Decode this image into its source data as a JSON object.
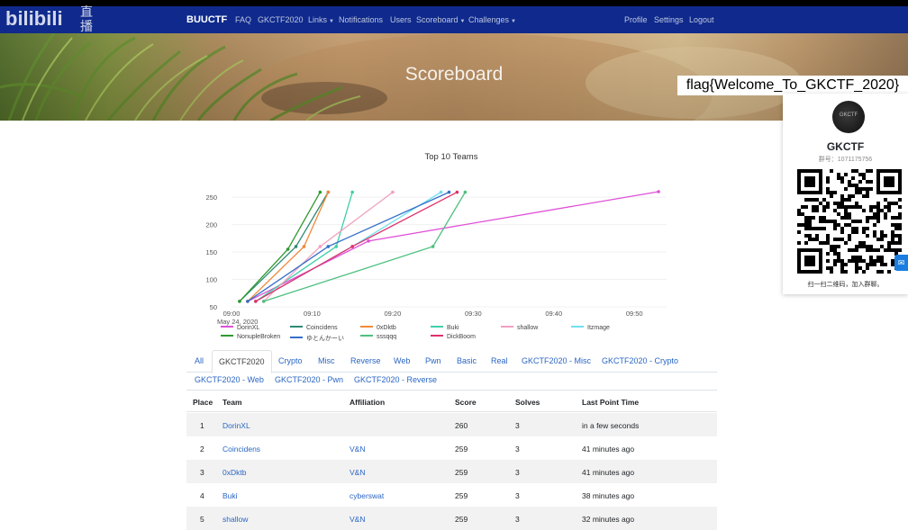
{
  "logo": {
    "text": "bilibili",
    "live_char_1": "直",
    "live_char_2": "播"
  },
  "navbar": {
    "brand": "BUUCTF",
    "left_items": [
      {
        "label": "FAQ"
      },
      {
        "label": "GKCTF2020"
      },
      {
        "label": "Links",
        "dropdown": true
      },
      {
        "label": "Notifications"
      },
      {
        "label": "Users"
      },
      {
        "label": "Scoreboard",
        "dropdown": true
      },
      {
        "label": "Challenges",
        "dropdown": true
      }
    ],
    "right_items": [
      {
        "label": "Profile"
      },
      {
        "label": "Settings"
      },
      {
        "label": "Logout"
      }
    ]
  },
  "hero": {
    "title": "Scoreboard"
  },
  "overlay": {
    "flag_text": "flag{Welcome_To_GKCTF_2020}",
    "group_name": "GKCTF",
    "group_id": "群号：1071175756",
    "qr_caption": "扫一扫二维码，加入群聊。",
    "avatar_text": "GKCTF"
  },
  "chart_data": {
    "type": "line",
    "title": "Top 10 Teams",
    "x_date_label": "May 24, 2020",
    "x_ticks": [
      "09:00",
      "09:10",
      "09:20",
      "09:30",
      "09:40",
      "09:50"
    ],
    "y_ticks": [
      50,
      100,
      150,
      200,
      250
    ],
    "xlim": [
      "09:00",
      "09:54"
    ],
    "ylim": [
      50,
      260
    ],
    "series": [
      {
        "name": "DorinXL",
        "color": "#e050d8",
        "points": [
          [
            "09:02",
            60
          ],
          [
            "09:17",
            170
          ],
          [
            "09:53",
            260
          ]
        ]
      },
      {
        "name": "Coincidens",
        "color": "#2e8b75",
        "points": [
          [
            "09:01",
            60
          ],
          [
            "09:08",
            160
          ],
          [
            "09:12",
            259
          ]
        ]
      },
      {
        "name": "0xDktb",
        "color": "#f08a3a",
        "points": [
          [
            "09:02",
            60
          ],
          [
            "09:09",
            160
          ],
          [
            "09:12",
            259
          ]
        ]
      },
      {
        "name": "Buki",
        "color": "#3fd0a8",
        "points": [
          [
            "09:03",
            60
          ],
          [
            "09:13",
            160
          ],
          [
            "09:15",
            259
          ]
        ]
      },
      {
        "name": "shallow",
        "color": "#f0a0c0",
        "points": [
          [
            "09:04",
            60
          ],
          [
            "09:11",
            160
          ],
          [
            "09:20",
            259
          ]
        ]
      },
      {
        "name": "Itzmage",
        "color": "#70e0f0",
        "points": [
          [
            "09:03",
            60
          ],
          [
            "09:15",
            160
          ],
          [
            "09:26",
            259
          ]
        ]
      },
      {
        "name": "NonupleBroken",
        "color": "#2f9a2f",
        "points": [
          [
            "09:01",
            60
          ],
          [
            "09:07",
            155
          ],
          [
            "09:11",
            259
          ]
        ]
      },
      {
        "name": "ゆとんかーい",
        "color": "#3670c8",
        "points": [
          [
            "09:02",
            60
          ],
          [
            "09:12",
            160
          ],
          [
            "09:27",
            259
          ]
        ]
      },
      {
        "name": "sssqqq",
        "color": "#4ec080",
        "points": [
          [
            "09:04",
            60
          ],
          [
            "09:25",
            160
          ],
          [
            "09:29",
            259
          ]
        ]
      },
      {
        "name": "DickBoom",
        "color": "#e0306a",
        "points": [
          [
            "09:03",
            60
          ],
          [
            "09:15",
            160
          ],
          [
            "09:28",
            259
          ]
        ]
      }
    ]
  },
  "tabs": {
    "row1": [
      {
        "label": "All",
        "active": false
      },
      {
        "label": "GKCTF2020",
        "active": true
      },
      {
        "label": "Crypto",
        "active": false
      },
      {
        "label": "Misc",
        "active": false
      },
      {
        "label": "Reverse",
        "active": false
      },
      {
        "label": "Web",
        "active": false
      },
      {
        "label": "Pwn",
        "active": false
      },
      {
        "label": "Basic",
        "active": false
      },
      {
        "label": "Real",
        "active": false
      },
      {
        "label": "GKCTF2020 - Misc",
        "active": false
      },
      {
        "label": "GKCTF2020 - Crypto",
        "active": false
      }
    ],
    "row2": [
      {
        "label": "GKCTF2020 - Web"
      },
      {
        "label": "GKCTF2020 - Pwn"
      },
      {
        "label": "GKCTF2020 - Reverse"
      }
    ]
  },
  "table": {
    "headers": [
      "Place",
      "Team",
      "Affiliation",
      "Score",
      "Solves",
      "Last Point Time"
    ],
    "rows": [
      {
        "place": "1",
        "team": "DorinXL",
        "affiliation": "",
        "score": "260",
        "solves": "3",
        "time": "in a few seconds"
      },
      {
        "place": "2",
        "team": "Coincidens",
        "affiliation": "V&N",
        "score": "259",
        "solves": "3",
        "time": "41 minutes ago"
      },
      {
        "place": "3",
        "team": "0xDktb",
        "affiliation": "V&N",
        "score": "259",
        "solves": "3",
        "time": "41 minutes ago"
      },
      {
        "place": "4",
        "team": "Buki",
        "affiliation": "cyberswat",
        "score": "259",
        "solves": "3",
        "time": "38 minutes ago"
      },
      {
        "place": "5",
        "team": "shallow",
        "affiliation": "V&N",
        "score": "259",
        "solves": "3",
        "time": "32 minutes ago"
      }
    ]
  }
}
